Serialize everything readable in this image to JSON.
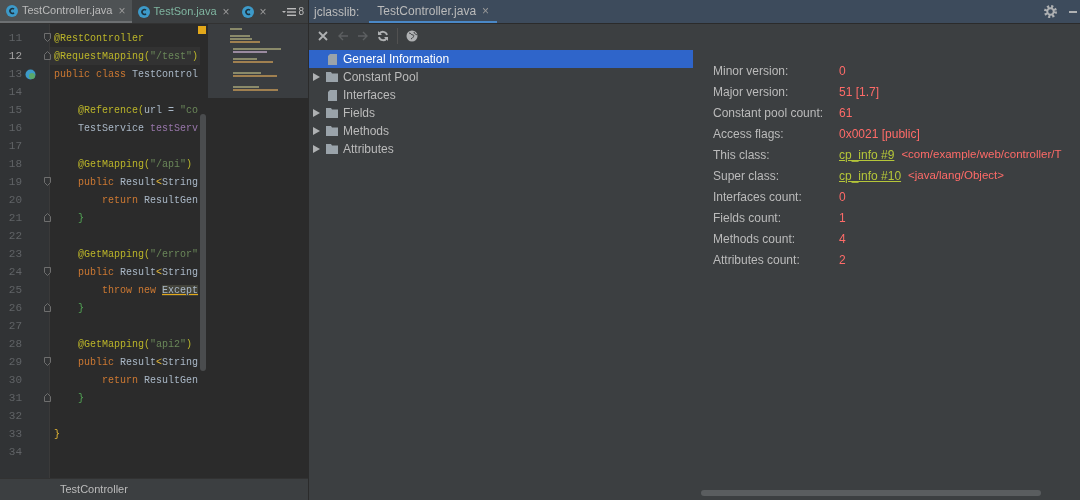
{
  "editor": {
    "tabs": [
      {
        "label": "TestController.java",
        "selected": true,
        "close": "×"
      },
      {
        "label": "TestSon.java",
        "selected": false,
        "close": "×"
      },
      {
        "selected": false,
        "close": "×"
      }
    ],
    "tab_overflow": "8",
    "lines": [
      {
        "number": "11",
        "current": false,
        "fold_open": true,
        "tokens": [
          {
            "kind": "annotation",
            "text": "@RestController"
          }
        ]
      },
      {
        "number": "12",
        "current": true,
        "fold_close": true,
        "tokens": [
          {
            "kind": "annotation",
            "text": "@RequestMapping("
          },
          {
            "kind": "string",
            "text": "\"/test\""
          },
          {
            "kind": "annotation",
            "text": ")"
          }
        ]
      },
      {
        "number": "13",
        "current": false,
        "implemented": true,
        "tokens": [
          {
            "kind": "keyword",
            "text": "public class "
          },
          {
            "kind": "plain",
            "text": "TestControl"
          }
        ]
      },
      {
        "number": "14",
        "current": false
      },
      {
        "number": "15",
        "current": false,
        "tokens": [
          {
            "kind": "annotation",
            "text": "    @Reference("
          },
          {
            "kind": "plain",
            "text": "url = "
          },
          {
            "kind": "string",
            "text": "\"co"
          }
        ]
      },
      {
        "number": "16",
        "current": false,
        "tokens": [
          {
            "kind": "plain",
            "text": "    TestService "
          },
          {
            "kind": "field",
            "text": "testServ"
          }
        ]
      },
      {
        "number": "17",
        "current": false
      },
      {
        "number": "18",
        "current": false,
        "tokens": [
          {
            "kind": "annotation",
            "text": "    @GetMapping("
          },
          {
            "kind": "string",
            "text": "\"/api\""
          },
          {
            "kind": "annotation",
            "text": ")"
          }
        ]
      },
      {
        "number": "19",
        "current": false,
        "fold_open": true,
        "tokens": [
          {
            "kind": "keyword",
            "text": "    public "
          },
          {
            "kind": "plain",
            "text": "Result"
          },
          {
            "kind": "brace",
            "text": "<"
          },
          {
            "kind": "plain",
            "text": "String"
          }
        ]
      },
      {
        "number": "20",
        "current": false,
        "tokens": [
          {
            "kind": "keyword",
            "text": "        return "
          },
          {
            "kind": "plain",
            "text": "ResultGen"
          }
        ]
      },
      {
        "number": "21",
        "current": false,
        "fold_close": true,
        "tokens": [
          {
            "kind": "inner",
            "text": "    }"
          }
        ]
      },
      {
        "number": "22",
        "current": false
      },
      {
        "number": "23",
        "current": false,
        "tokens": [
          {
            "kind": "annotation",
            "text": "    @GetMapping("
          },
          {
            "kind": "string",
            "text": "\"/error\""
          }
        ]
      },
      {
        "number": "24",
        "current": false,
        "fold_open": true,
        "tokens": [
          {
            "kind": "keyword",
            "text": "    public "
          },
          {
            "kind": "plain",
            "text": "Result"
          },
          {
            "kind": "brace",
            "text": "<"
          },
          {
            "kind": "plain",
            "text": "String"
          }
        ]
      },
      {
        "number": "25",
        "current": false,
        "tokens": [
          {
            "kind": "keyword",
            "text": "        throw new "
          },
          {
            "kind": "warning",
            "text": "Except"
          }
        ]
      },
      {
        "number": "26",
        "current": false,
        "fold_close": true,
        "tokens": [
          {
            "kind": "inner",
            "text": "    }"
          }
        ]
      },
      {
        "number": "27",
        "current": false
      },
      {
        "number": "28",
        "current": false,
        "tokens": [
          {
            "kind": "annotation",
            "text": "    @GetMapping("
          },
          {
            "kind": "string",
            "text": "\"api2\""
          },
          {
            "kind": "annotation",
            "text": ")"
          }
        ]
      },
      {
        "number": "29",
        "current": false,
        "fold_open": true,
        "tokens": [
          {
            "kind": "keyword",
            "text": "    public "
          },
          {
            "kind": "plain",
            "text": "Result"
          },
          {
            "kind": "brace",
            "text": "<"
          },
          {
            "kind": "plain",
            "text": "String"
          }
        ]
      },
      {
        "number": "30",
        "current": false,
        "tokens": [
          {
            "kind": "keyword",
            "text": "        return "
          },
          {
            "kind": "plain",
            "text": "ResultGen"
          }
        ]
      },
      {
        "number": "31",
        "current": false,
        "fold_close": true,
        "tokens": [
          {
            "kind": "inner",
            "text": "    }"
          }
        ]
      },
      {
        "number": "32",
        "current": false
      },
      {
        "number": "33",
        "current": false,
        "tokens": [
          {
            "kind": "brace",
            "text": "}"
          }
        ]
      },
      {
        "number": "34",
        "current": false
      }
    ],
    "breadcrumb": "TestController"
  },
  "jclasslib": {
    "title": "jclasslib:",
    "tab": {
      "label": "TestController.java",
      "selected": true,
      "close": "×"
    },
    "toolbar": [
      {
        "kind": "close",
        "disabled": false
      },
      {
        "kind": "back",
        "disabled": true
      },
      {
        "kind": "forward",
        "disabled": true
      },
      {
        "kind": "refresh",
        "disabled": false
      },
      {
        "kind": "web",
        "disabled": false
      }
    ],
    "tree": [
      {
        "label": "General Information",
        "kind": "file",
        "selected": true
      },
      {
        "label": "Constant Pool",
        "kind": "folder",
        "selected": false
      },
      {
        "label": "Interfaces",
        "kind": "file",
        "selected": false
      },
      {
        "label": "Fields",
        "kind": "folder",
        "selected": false
      },
      {
        "label": "Methods",
        "kind": "folder",
        "selected": false
      },
      {
        "label": "Attributes",
        "kind": "folder",
        "selected": false
      }
    ],
    "details": [
      {
        "label": "Minor version:",
        "value": "0"
      },
      {
        "label": "Major version:",
        "value": "51 [1.7]"
      },
      {
        "label": "Constant pool count:",
        "value": "61"
      },
      {
        "label": "Access flags:",
        "value": "0x0021 [public]"
      },
      {
        "label": "This class:",
        "link": "cp_info #9",
        "value": "<com/example/web/controller/T"
      },
      {
        "label": "Super class:",
        "link": "cp_info #10",
        "value": "<java/lang/Object>"
      },
      {
        "label": "Interfaces count:",
        "value": "0"
      },
      {
        "label": "Fields count:",
        "value": "1"
      },
      {
        "label": "Methods count:",
        "value": "4"
      },
      {
        "label": "Attributes count:",
        "value": "2"
      }
    ]
  }
}
